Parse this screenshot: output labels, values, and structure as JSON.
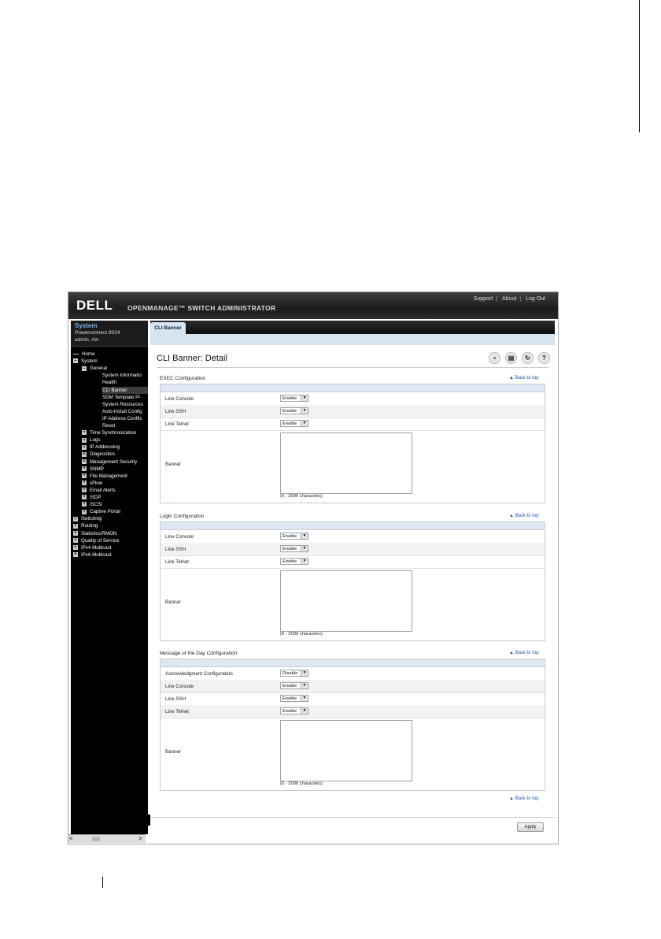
{
  "header": {
    "logo": "DELL",
    "app_title": "OPENMANAGE™ SWITCH ADMINISTRATOR",
    "links": [
      "Support",
      "About",
      "Log Out"
    ]
  },
  "nav": {
    "system_title": "System",
    "model": "Powerconnect 8024",
    "user": "admin, r/w",
    "items": [
      {
        "label": "Home",
        "level": 0,
        "icon": "dash"
      },
      {
        "label": "System",
        "level": 0,
        "icon": "minus"
      },
      {
        "label": "General",
        "level": 1,
        "icon": "minus"
      },
      {
        "label": "System Informatio",
        "level": 2,
        "icon": "none"
      },
      {
        "label": "Health",
        "level": 2,
        "icon": "none"
      },
      {
        "label": "CLI Banner",
        "level": 2,
        "icon": "none",
        "selected": true
      },
      {
        "label": "SDM Template Pr",
        "level": 2,
        "icon": "none"
      },
      {
        "label": "System Resources",
        "level": 2,
        "icon": "none"
      },
      {
        "label": "Auto-Install Config",
        "level": 2,
        "icon": "none"
      },
      {
        "label": "IP Address Conflic",
        "level": 2,
        "icon": "none"
      },
      {
        "label": "Reset",
        "level": 2,
        "icon": "none"
      },
      {
        "label": "Time Synchronization",
        "level": 1,
        "icon": "plus"
      },
      {
        "label": "Logs",
        "level": 1,
        "icon": "plus"
      },
      {
        "label": "IP Addressing",
        "level": 1,
        "icon": "plus"
      },
      {
        "label": "Diagnostics",
        "level": 1,
        "icon": "plus"
      },
      {
        "label": "Management Security",
        "level": 1,
        "icon": "plus"
      },
      {
        "label": "SNMP",
        "level": 1,
        "icon": "plus"
      },
      {
        "label": "File Management",
        "level": 1,
        "icon": "plus"
      },
      {
        "label": "sFlow",
        "level": 1,
        "icon": "plus"
      },
      {
        "label": "Email Alerts",
        "level": 1,
        "icon": "plus"
      },
      {
        "label": "ISDP",
        "level": 1,
        "icon": "plus"
      },
      {
        "label": "iSCSI",
        "level": 1,
        "icon": "plus"
      },
      {
        "label": "Captive Portal",
        "level": 1,
        "icon": "plus"
      },
      {
        "label": "Switching",
        "level": 0,
        "icon": "plus"
      },
      {
        "label": "Routing",
        "level": 0,
        "icon": "plus"
      },
      {
        "label": "Statistics/RMON",
        "level": 0,
        "icon": "plus"
      },
      {
        "label": "Quality of Service",
        "level": 0,
        "icon": "plus"
      },
      {
        "label": "IPv4 Multicast",
        "level": 0,
        "icon": "plus"
      },
      {
        "label": "IPv6 Multicast",
        "level": 0,
        "icon": "plus"
      }
    ]
  },
  "tab": {
    "label": "CLI Banner"
  },
  "page_title": "CLI Banner: Detail",
  "toolbar_icons": [
    "save-icon",
    "print-icon",
    "refresh-icon",
    "help-icon"
  ],
  "back_to_top": "▲ Back to top",
  "chars_hint": "(0 - 2000 characters)",
  "sections": [
    {
      "title": "EXEC Configuration",
      "rows": [
        {
          "label": "Line Console",
          "value": "Enable"
        },
        {
          "label": "Line SSH",
          "value": "Enable"
        },
        {
          "label": "Line Telnet",
          "value": "Enable"
        }
      ],
      "banner_label": "Banner"
    },
    {
      "title": "Login Configuration",
      "rows": [
        {
          "label": "Line Console",
          "value": "Enable"
        },
        {
          "label": "Line SSH",
          "value": "Enable"
        },
        {
          "label": "Line Telnet",
          "value": "Enable"
        }
      ],
      "banner_label": "Banner"
    },
    {
      "title": "Message of the Day Configuration",
      "rows": [
        {
          "label": "Acknowledgment Configuration",
          "value": "Disable"
        },
        {
          "label": "Line Console",
          "value": "Enable"
        },
        {
          "label": "Line SSH",
          "value": "Enable"
        },
        {
          "label": "Line Telnet",
          "value": "Enable"
        }
      ],
      "banner_label": "Banner"
    }
  ],
  "apply_label": "Apply",
  "scroll_left": "<",
  "scroll_right": ">"
}
